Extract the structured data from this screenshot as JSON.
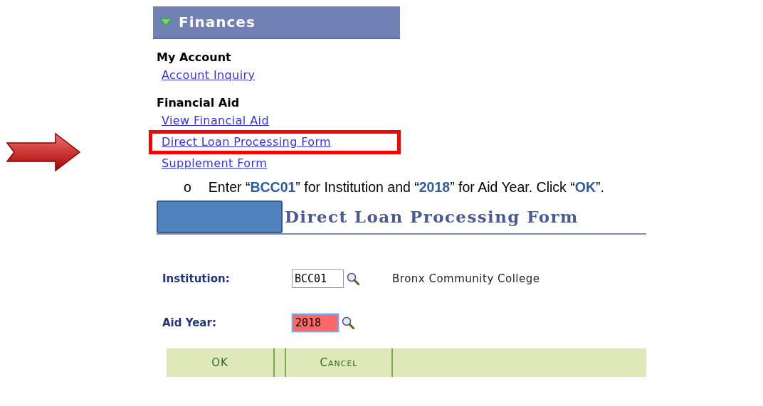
{
  "menu": {
    "title": "Finances",
    "expanded": true,
    "groups": [
      {
        "heading": "My Account",
        "links": [
          {
            "label": "Account Inquiry",
            "highlighted": false
          }
        ]
      },
      {
        "heading": "Financial Aid",
        "links": [
          {
            "label": "View Financial Aid",
            "highlighted": false
          },
          {
            "label": "Direct Loan Processing Form",
            "highlighted": true
          },
          {
            "label": "Supplement Form",
            "highlighted": false
          }
        ]
      }
    ]
  },
  "instruction": {
    "bullet": "o",
    "text": "Enter “**BCC01**” for Institution and “**2018**” for Aid Year. Click “**OK**”."
  },
  "form": {
    "title": "Direct Loan Processing Form",
    "fields": [
      {
        "label": "Institution:",
        "value": "BCC01",
        "focused": false,
        "error": false,
        "description": "Bronx Community College"
      },
      {
        "label": "Aid Year:",
        "value": "2018",
        "focused": true,
        "error": true
      }
    ],
    "buttons": [
      "OK",
      "Cancel"
    ]
  }
}
